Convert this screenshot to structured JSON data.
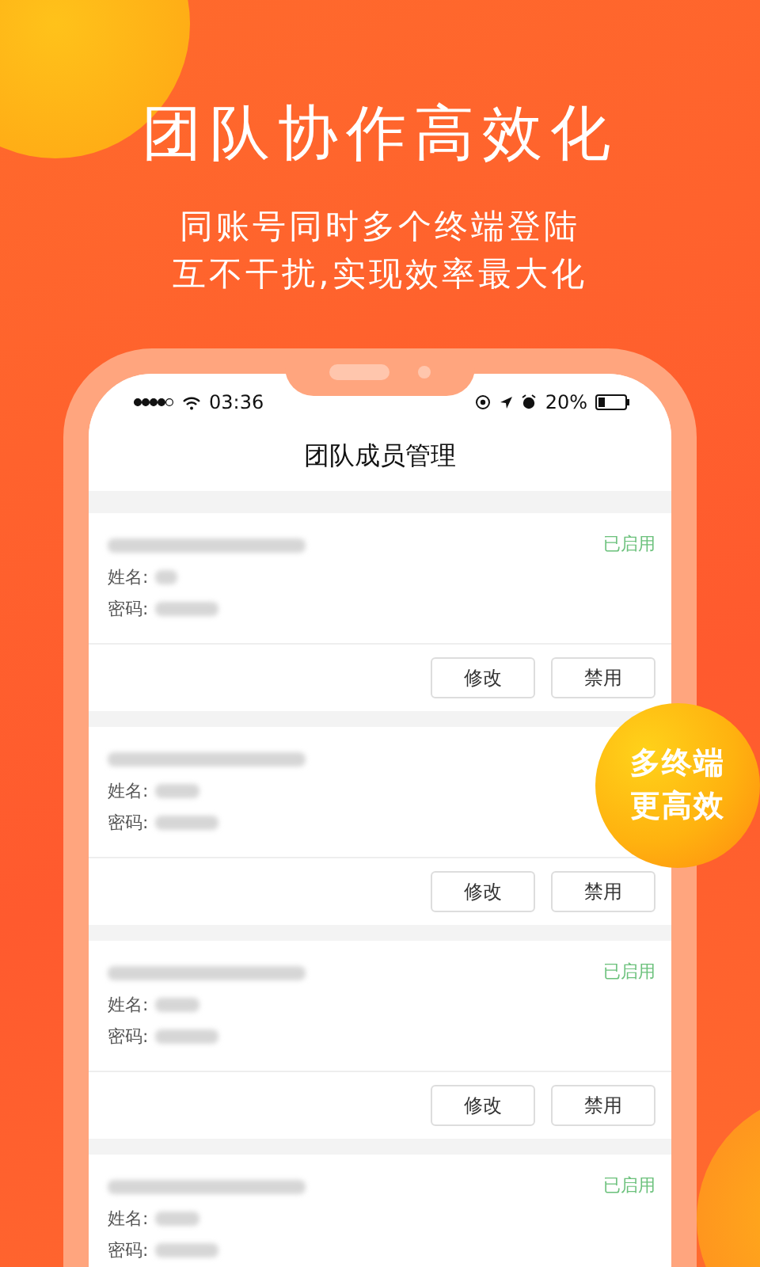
{
  "headline": "团队协作高效化",
  "subtitle": [
    "同账号同时多个终端登陆",
    "互不干扰,实现效率最大化"
  ],
  "status_bar": {
    "time": "03:36",
    "battery": "20%"
  },
  "screen_title": "团队成员管理",
  "cards": [
    {
      "status": "已启用",
      "name_label": "姓名:",
      "password_label": "密码:",
      "buttons": [
        "修改",
        "禁用"
      ]
    },
    {
      "name_label": "姓名:",
      "password_label": "密码:",
      "buttons": [
        "修改",
        "禁用"
      ]
    },
    {
      "status": "已启用",
      "name_label": "姓名:",
      "password_label": "密码:",
      "buttons": [
        "修改",
        "禁用"
      ]
    },
    {
      "status": "已启用",
      "name_label": "姓名:",
      "password_label": "密码:"
    }
  ],
  "badge": [
    "多终端",
    "更高效"
  ]
}
